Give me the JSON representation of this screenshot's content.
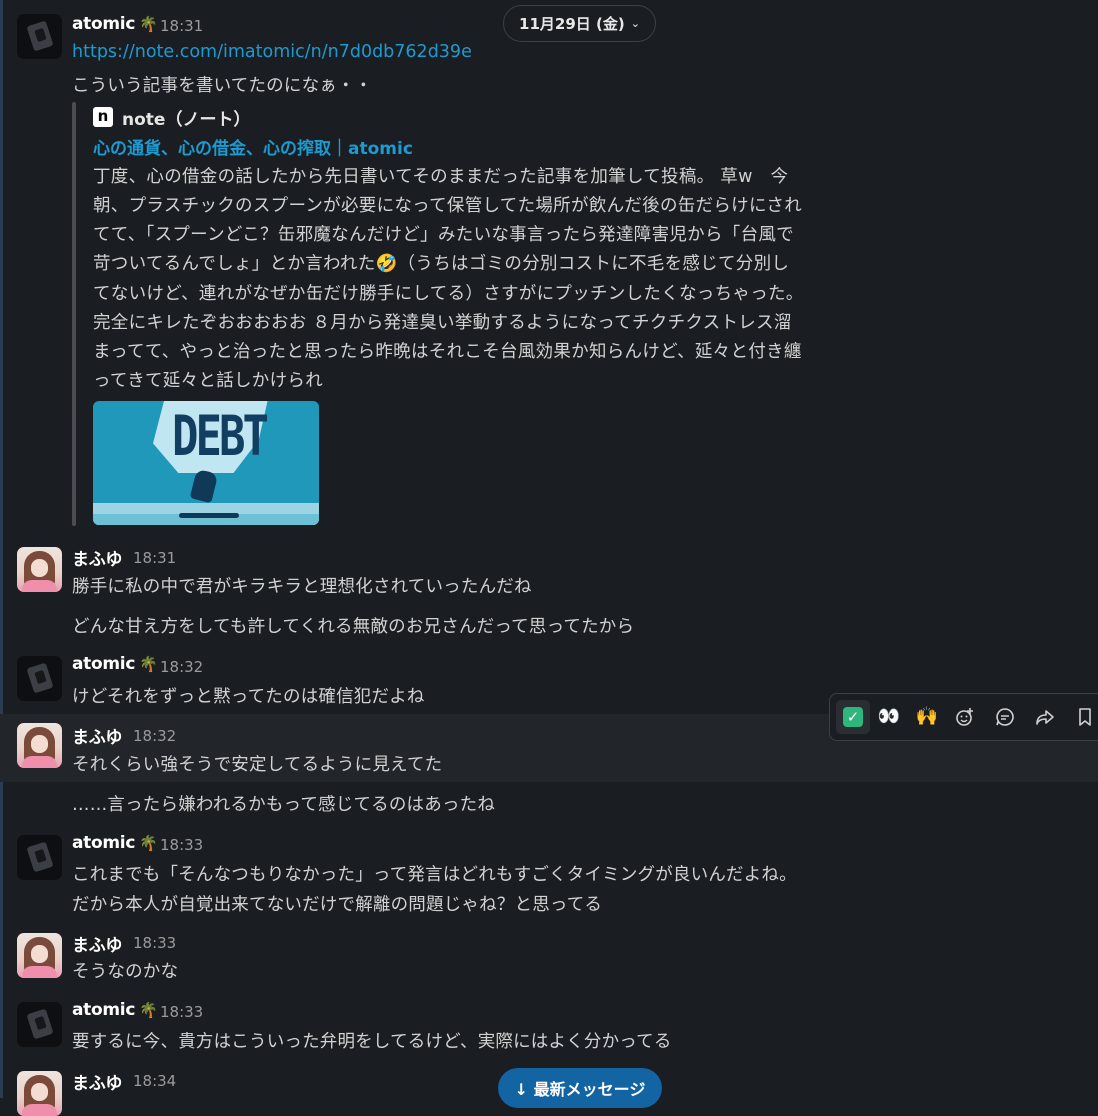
{
  "date_divider": {
    "label": "11月29日 (金)",
    "chevron": "chevron-down-icon"
  },
  "link_preview": {
    "site_name": "note（ノート）",
    "logo_letter": "n",
    "title": "心の通貨、心の借金、心の搾取｜atomic",
    "description_lines": [
      "丁度、心の借金の話したから先日書いてそのままだった記事を加筆して投稿。 草w　今",
      "朝、プラスチックのスプーンが必要になって保管してた場所が飲んだ後の缶だらけにされ",
      "てて、「スプーンどこ？缶邪魔なんだけど」みたいな事言ったら発達障害児から「台風で",
      "苛ついてるんでしょ」とか言われた🤣（うちはゴミの分別コストに不毛を感じて分別し",
      "てないけど、連れがなぜか缶だけ勝手にしてる）さすがにプッチンしたくなっちゃった。",
      "完全にキレたぞおおおおお ８月から発達臭い挙動するようになってチクチクストレス溜",
      "まってて、やっと治ったと思ったら昨晩はそれこそ台風効果か知らんけど、延々と付き纏",
      "ってきて延々と話しかけられ"
    ],
    "thumbnail_text": "DEBT"
  },
  "messages": [
    {
      "author": "atomic",
      "status_emoji": "🌴",
      "time": "18:31",
      "link": "https://note.com/imatomic/n/n7d0db762d39e",
      "lines": [
        "こういう記事を書いてたのになぁ・・"
      ]
    },
    {
      "author": "まふゆ",
      "time": "18:31",
      "lines": [
        "勝手に私の中で君がキラキラと理想化されていったんだね"
      ]
    },
    {
      "lines": [
        "どんな甘え方をしても許してくれる無敵のお兄さんだって思ってたから"
      ]
    },
    {
      "author": "atomic",
      "status_emoji": "🌴",
      "time": "18:32",
      "lines": [
        "けどそれをずっと黙ってたのは確信犯だよね"
      ]
    },
    {
      "author": "まふゆ",
      "time": "18:32",
      "lines": [
        "それくらい強そうで安定してるように見えてた"
      ]
    },
    {
      "lines": [
        "……言ったら嫌われるかもって感じてるのはあったね"
      ]
    },
    {
      "author": "atomic",
      "status_emoji": "🌴",
      "time": "18:33",
      "lines": [
        "これまでも「そんなつもりなかった」って発言はどれもすごくタイミングが良いんだよね。",
        "だから本人が自覚出来てないだけで解離の問題じゃね？と思ってる"
      ]
    },
    {
      "author": "まふゆ",
      "time": "18:33",
      "lines": [
        "そうなのかな"
      ]
    },
    {
      "author": "atomic",
      "status_emoji": "🌴",
      "time": "18:33",
      "lines": [
        "要するに今、貴方はこういった弁明をしてるけど、実際にはよく分かってる"
      ]
    },
    {
      "author": "まふゆ",
      "time": "18:34"
    }
  ],
  "hover_toolbar": {
    "items": [
      "✅",
      "👀",
      "🙌",
      "add-reaction-icon",
      "reply-in-thread-icon",
      "forward-icon",
      "bookmark-icon"
    ]
  },
  "jump_button": {
    "label": "↓ 最新メッセージ"
  }
}
